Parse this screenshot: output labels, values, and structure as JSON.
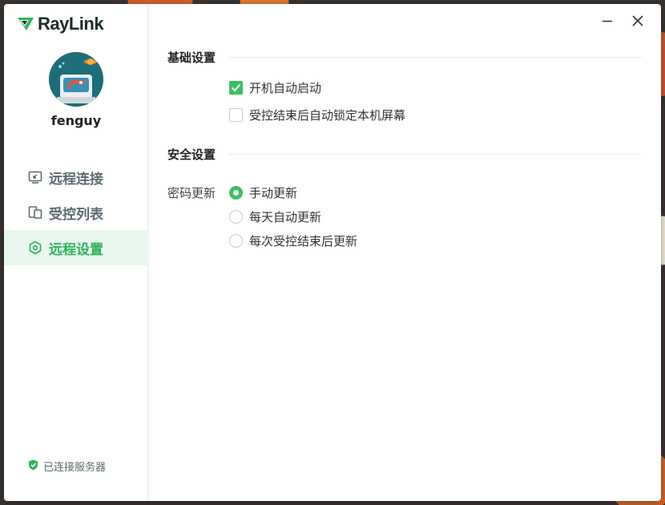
{
  "app": {
    "logo_text": "RayLink",
    "accent_color": "#3cc05f"
  },
  "user": {
    "name": "fenguy"
  },
  "sidebar": {
    "items": [
      {
        "label": "远程连接",
        "icon": "remote-connect-icon",
        "active": false
      },
      {
        "label": "受控列表",
        "icon": "controlled-list-icon",
        "active": false
      },
      {
        "label": "远程设置",
        "icon": "settings-hex-icon",
        "active": true
      }
    ],
    "server_status": "已连接服务器"
  },
  "settings": {
    "basic": {
      "title": "基础设置",
      "options": [
        {
          "label": "开机自动启动",
          "checked": true
        },
        {
          "label": "受控结束后自动锁定本机屏幕",
          "checked": false
        }
      ]
    },
    "security": {
      "title": "安全设置",
      "password_label": "密码更新",
      "radio_options": [
        {
          "label": "手动更新",
          "checked": true
        },
        {
          "label": "每天自动更新",
          "checked": false
        },
        {
          "label": "每次受控结束后更新",
          "checked": false
        }
      ]
    }
  }
}
